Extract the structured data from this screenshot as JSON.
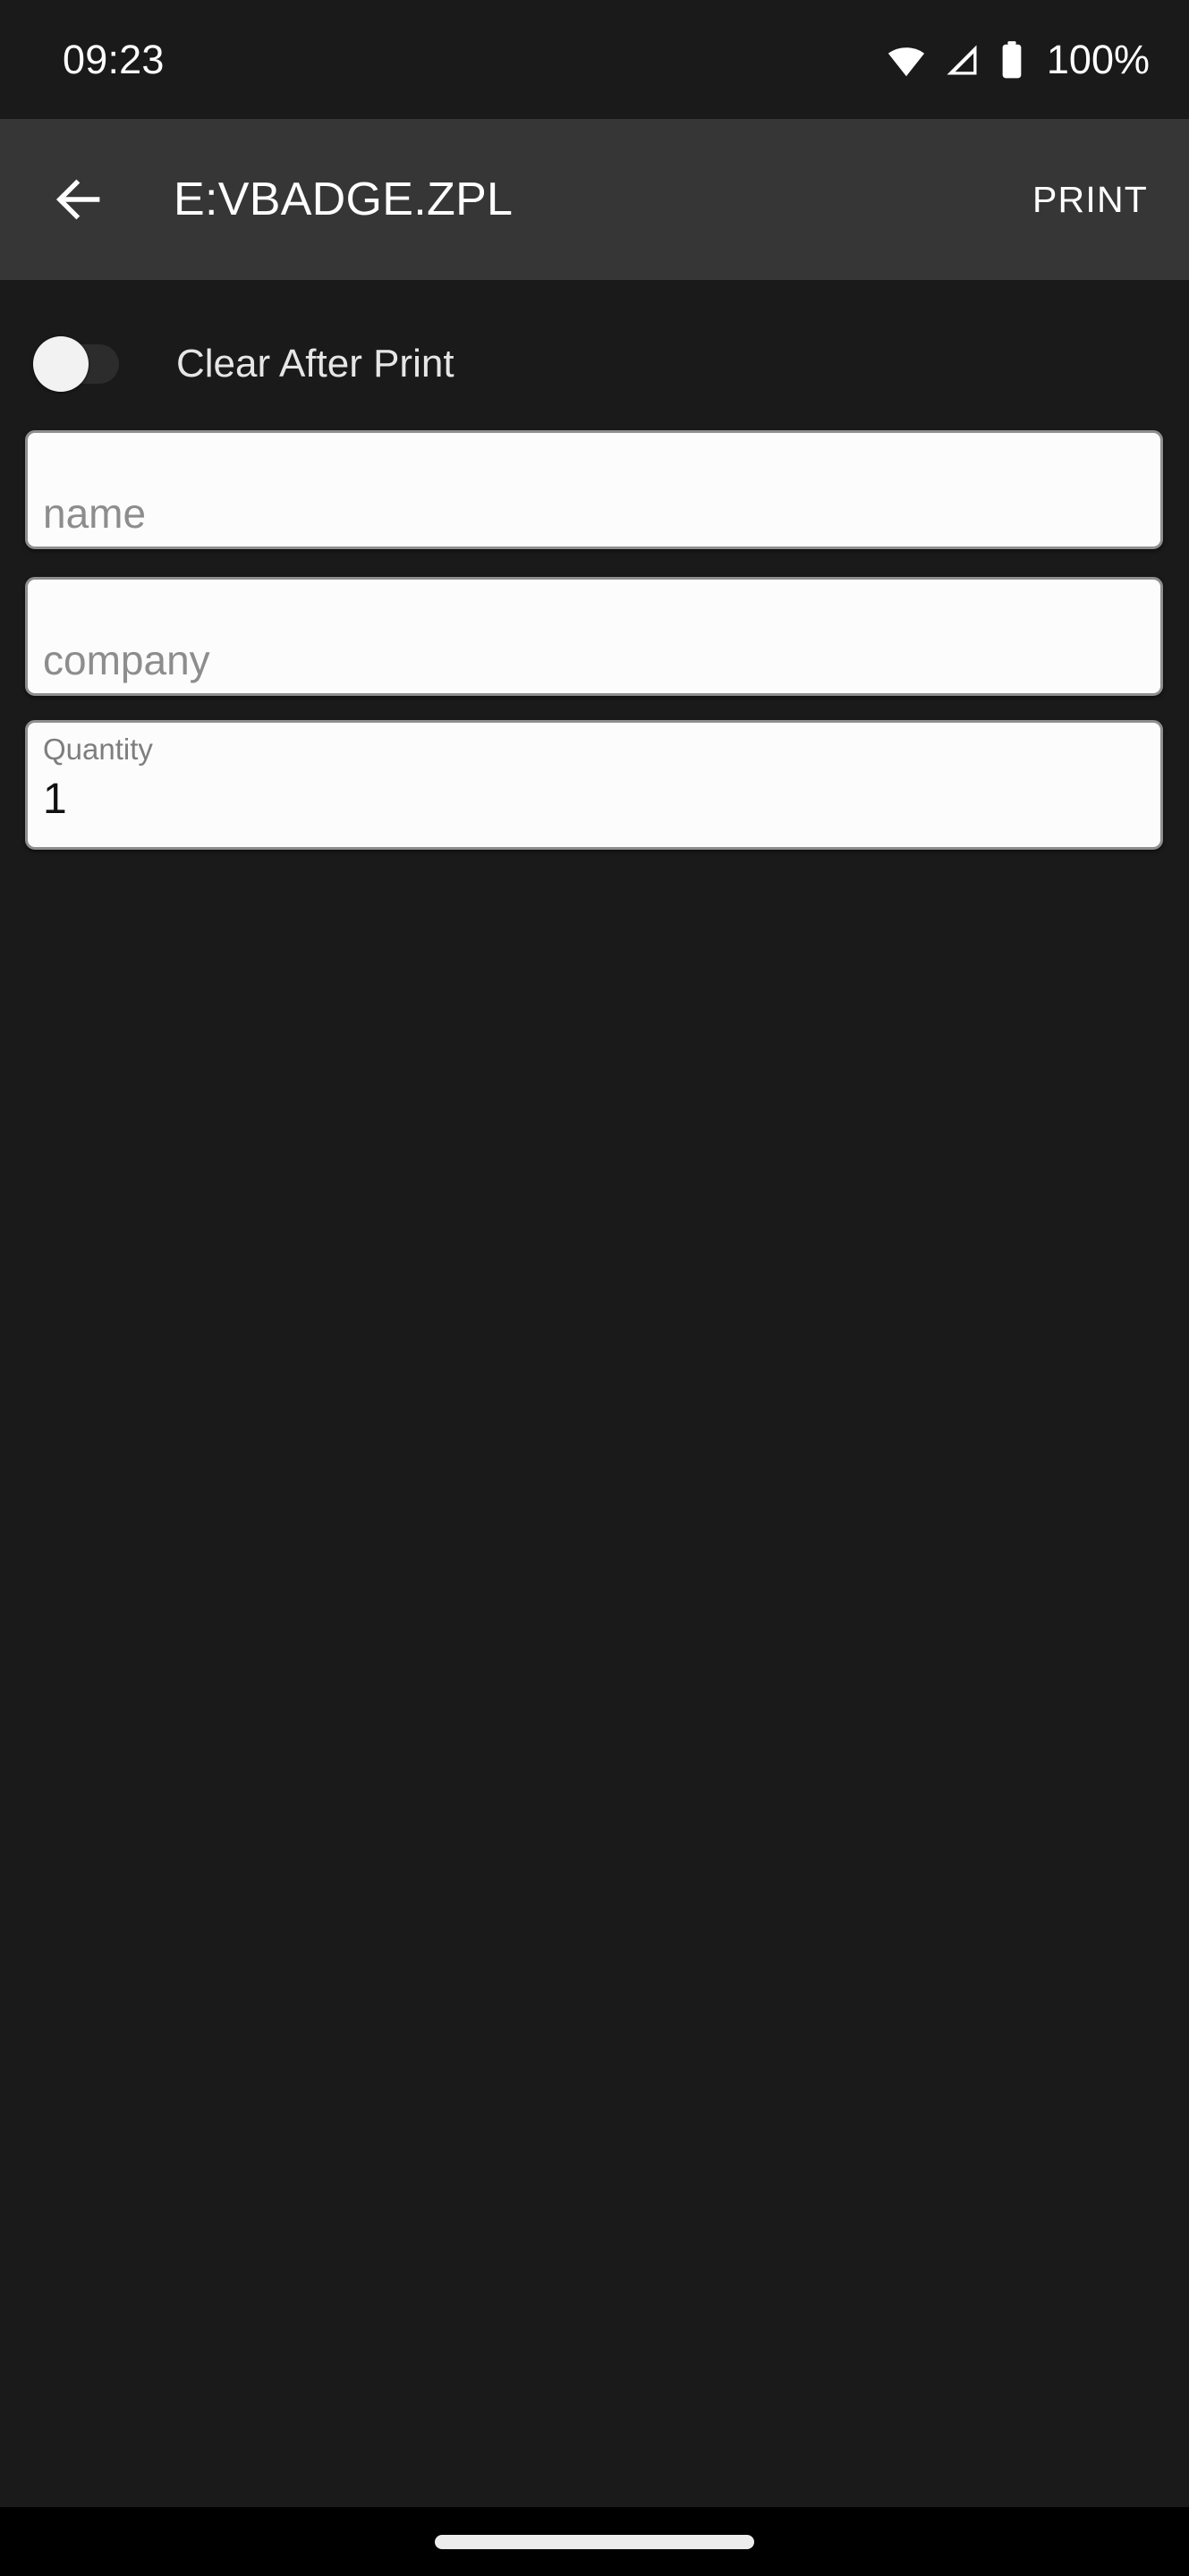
{
  "status_bar": {
    "clock": "09:23",
    "battery_percent": "100%",
    "icons": [
      "wifi-icon",
      "cellular-signal-icon",
      "battery-icon"
    ],
    "background_color": "#1a1a1a",
    "text_color": "#ffffff"
  },
  "app_bar": {
    "back_icon": "arrow-left-icon",
    "title": "E:VBADGE.ZPL",
    "action_label": "PRINT",
    "background_color": "#363636",
    "text_color": "#ffffff"
  },
  "content": {
    "toggle": {
      "label": "Clear After Print",
      "checked": false,
      "thumb_color": "#f2f2f2",
      "track_color": "#2c2c2c"
    },
    "fields": [
      {
        "name": "name",
        "placeholder": "name",
        "value": "",
        "label": "",
        "background_color": "#fcfcfc",
        "border_color": "#8e8e8e"
      },
      {
        "name": "company",
        "placeholder": "company",
        "value": "",
        "label": "",
        "background_color": "#fcfcfc",
        "border_color": "#8e8e8e"
      },
      {
        "name": "quantity",
        "placeholder": "",
        "value": "1",
        "label": "Quantity",
        "background_color": "#fcfcfc",
        "border_color": "#8e8e8e"
      }
    ],
    "background_color": "#1a1a1a"
  },
  "navigation": {
    "home_indicator": "home-gesture-pill",
    "background_color": "#000000",
    "pill_color": "#ececec"
  }
}
